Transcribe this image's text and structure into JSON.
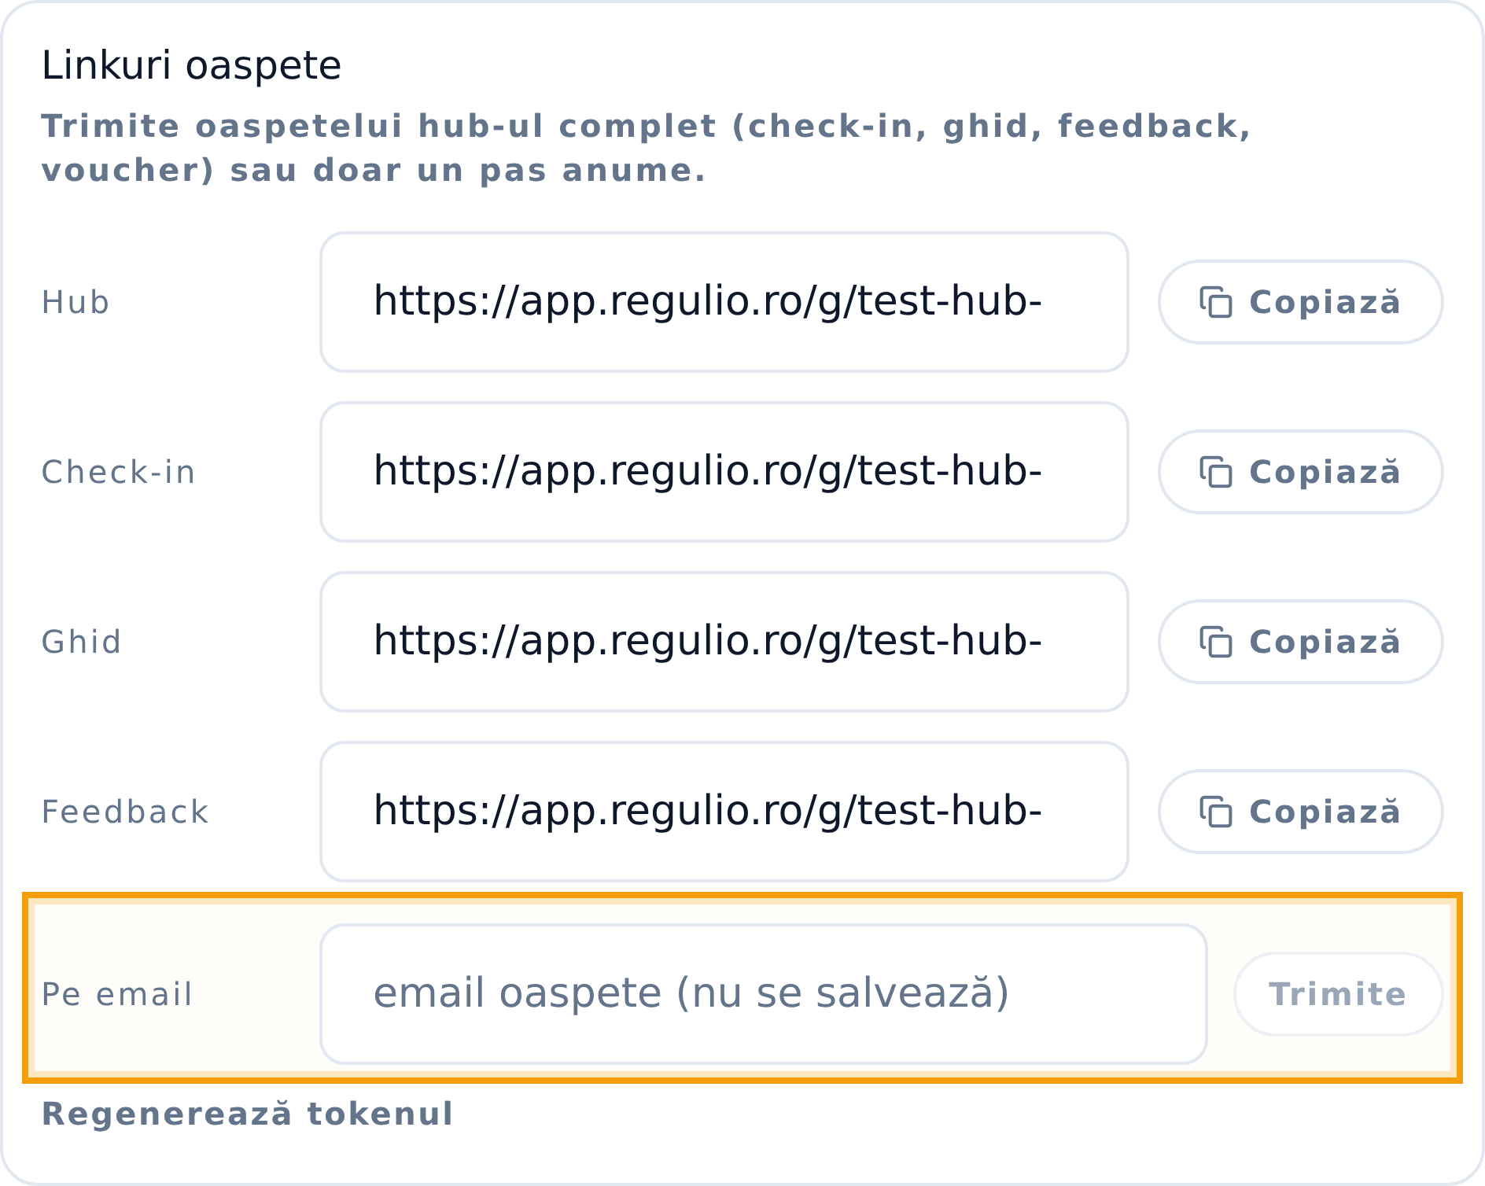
{
  "card": {
    "title": "Linkuri oaspete",
    "description": "Trimite oaspetelui hub-ul complet (check-in, ghid, feedback, voucher) sau doar un pas anume."
  },
  "links": [
    {
      "label": "Hub",
      "value": "https://app.regulio.ro/g/test-hub-",
      "button": "Copiază"
    },
    {
      "label": "Check-in",
      "value": "https://app.regulio.ro/g/test-hub-",
      "button": "Copiază"
    },
    {
      "label": "Ghid",
      "value": "https://app.regulio.ro/g/test-hub-",
      "button": "Copiază"
    },
    {
      "label": "Feedback",
      "value": "https://app.regulio.ro/g/test-hub-",
      "button": "Copiază"
    }
  ],
  "email": {
    "label": "Pe email",
    "placeholder": "email oaspete (nu se salvează)",
    "button": "Trimite",
    "disabled": true,
    "highlighted": true
  },
  "regenerate": "Regenerează tokenul"
}
